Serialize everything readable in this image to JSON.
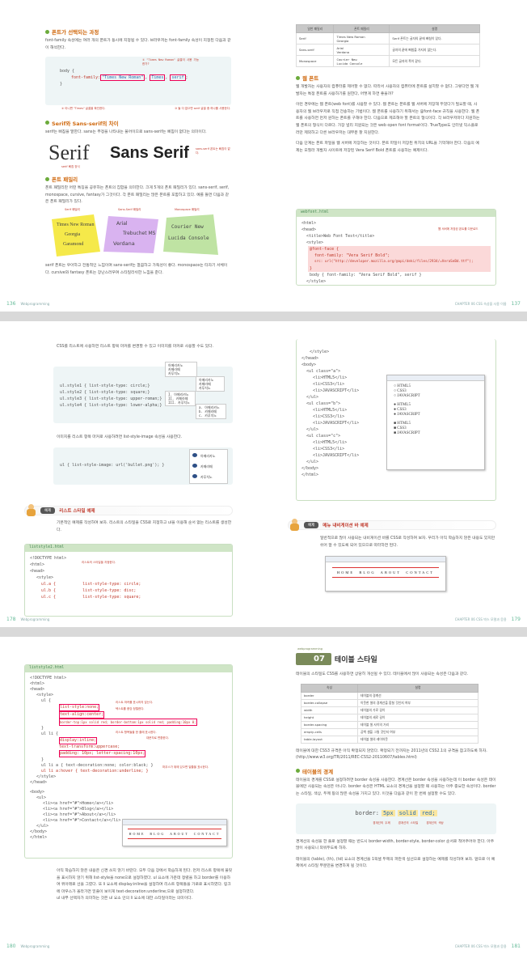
{
  "spread1": {
    "left": {
      "h1": "폰트가 선택되는 과정",
      "p1": "font-family 속성에는 여러 개의 폰트가 동시에 지정될 수 있다. 브라우저는 font-family 속성이 지정된 다음과 같이 해석한다.",
      "code1_body": "body {",
      "code1_prop": "font-family:",
      "code1_v1": "\"Times New Roman\"",
      "code1_v2": "Times",
      "code1_v3": "serif",
      "code1_end": "}",
      "note1": "① \"Times New Roman\" 글꼴이 사용 가능 한가?",
      "note2": "② 아니면 \"Times\" 글꼴을 확인한다.",
      "note3": "③ 둘 다 없으면 serif 글꼴 중 하나를 사용한다.",
      "h2": "Serif와 Sans-serif의 차이",
      "p2": "serif는 삐침을 말한다. sans는 부정을 나타내는 불어이므로 sans-serif는 삐침이 없다는 의미이다.",
      "serif_label": "Serif",
      "sans_label": "Sans Serif",
      "serif_note": "serif 삐침 장식",
      "sans_note": "sans-serif 폰트는 삐침이 없다.",
      "h3": "폰트 패밀리",
      "p3": "폰트 패밀리란 어떤 특징을 공유하는 폰트의 집합을 의미한다. 크게 5개의 폰트 패밀리가 있다. sans-serif, serif, monospace, cursive, fantasy가 그것이다. 각 폰트 패밀리는 많은 폰트를 포함하고 있다. 예를 들면 다음과 같은 폰트 패밀리가 있다.",
      "fam1": "Serif 패밀리",
      "fam2": "Sans-Serif 패밀리",
      "fam3": "Monospace 패밀리",
      "f1a": "Times New Roman",
      "f1b": "Georgia",
      "f1c": "Garamond",
      "f2a": "Arial",
      "f2b": "Trebuchet MS",
      "f2c": "Verdana",
      "f3a": "Courier New",
      "f3b": "Lucida Console",
      "p4": "serif 폰트는 우아하고 전통적인 느낌이며 sans-serif는 깔끔하고 가독성이 좋다. monospace는 타자기 서체이다. cursive와 fantasy 폰트는 장난스러우며 스타일리쉬한 느낌을 준다.",
      "page": "136",
      "running": "Webprogramming"
    },
    "right": {
      "th1": "일반 패밀리",
      "th2": "폰트 패밀리",
      "th3": "설명",
      "rows": [
        [
          "Serif",
          "Times New Roman\nGeorgia",
          "Serif 폰트는 글자의 끝에 삐침이 있다."
        ],
        [
          "Sans-serif",
          "Arial\nVerdana",
          "글자의 끝에 삐침을 가지지 않는다."
        ],
        [
          "Monospace",
          "Courier New\nLucida Console",
          "모든 글자의 폭이 같다."
        ]
      ],
      "h1": "웹 폰트",
      "p1": "웹 개발자는 사용자의 컴퓨터를 제어할 수 없다. 따라서 사용자의 컴퓨터에 폰트를 설치할 수 없다. 그렇다면 웹 개발자는 특정 폰트를 사용하기를 원한다, 어떻게 하면 좋을까?",
      "p2": "이런 경우에는 웹 폰트(web font)를 사용할 수 있다. 웹 폰트는 폰트를 웹 서버에 저장해 두었다가 필요할 때, 사용자의 웹 브라우저로 직접 전송하는 기법이다. 웹 폰트를 사용하기 위해서는 @font-face 규칙을 사용한다. 웹 폰트를 사용하면 먼저 원하는 폰트를 구해야 한다. 다음으로 제조해야 할 폰트의 형식이다. 각 브라우저마다 지원하는 웹 폰트의 형식이 다르다. 가장 널리 지원되는 것은 web open font format이다. TrueType도 인터넷 익스플로러만 제외하고 다른 브라우저는 대부분 잘 지원한다.",
      "p3": "다음 단계는 폰트 파일을 웹 서버에 저장하는 것이다. 폰트 파일이 저장된 위치의 URL을 기억해야 한다. 다음의 예제는 모질라 개발자 사이트에 저장된 Vera Serif Bold 폰트를 사용하는 예제이다.",
      "src_title": "webfont.html",
      "c1": "<html>",
      "c2": "<head>",
      "c3": "<title>Web Font Test</title>",
      "c4": "<style>",
      "c5": "@font-face {",
      "c6": "font-family: \"Vera Serif Bold\";",
      "c7": "src: url(\"http://developer.mozilla.org/@api/deki/files/2934/=VeraSeBd.ttf\");",
      "c8": "}",
      "c9": "body { font-family: \"Vera Serif Bold\", serif }",
      "c10": "</style>",
      "c_note": "웹 서버에 저장된 폰트를 다운로드",
      "page": "137",
      "running": "CHAPTER 06 CSS 속성을 사용 이름"
    }
  },
  "spread2": {
    "left": {
      "p1": "CSS를 리스트에 사용하면 리스트 항목 마커를 변경할 수 있고 이미지를 마커로 사용할 수도 있다.",
      "l1": "ul.style1 { list-style-type: circle;}",
      "l2": "ul.style2 { list-style-type: square;}",
      "l3": "ul.style3 { list-style-type: upper-roman;}",
      "l4": "ul.style4 { list-style-type: lower-alpha;}",
      "s1": [
        "아메리카노",
        "카페라떼",
        "카푸치노"
      ],
      "s2": [
        "아메리카노",
        "카페라떼",
        "카푸치노"
      ],
      "s3": [
        "I. 아메리카노",
        "II. 카페라떼",
        "III. 카푸치노"
      ],
      "s4": [
        "a. 아메리카노",
        "b. 카페라떼",
        "c. 카푸치노"
      ],
      "p2": "이미지를 리스트 항목 마커로 사용하려면 list-style-image 속성을 사용한다.",
      "l5": "ul { list-style-image: url('bullet.png'); }",
      "img_items": [
        "아메리카노",
        "카페라떼",
        "카푸치노"
      ],
      "ex_tag": "예제",
      "ex_title": "리스트 스타일 예제",
      "p3": "기본적인 예제를 작성하여 보자. 리스트의 스타일을 CSS로 지정하고 ul을 이용해 순서 없는 리스트를 생성한다.",
      "src_title": "liststyle1.html",
      "c1": "<!DOCTYPE html>",
      "c2": "<html>",
      "c3": "<head>",
      "c4": "<style>",
      "c5": "ul.a {           list-style-type: circle;",
      "c6": "ul.b {           list-style-type: disc;",
      "c7": "ul.c {           list-style-type: square;",
      "c_note": "리스트의 스타일을 지정한다.",
      "page": "178",
      "running": "Webprogramming"
    },
    "right": {
      "c1": "</style>",
      "c2": "</head>",
      "c3": "<body>",
      "c4": "<ul class=\"a\">",
      "c5": "<li>HTML5</li>",
      "c6": "<li>CSS3</li>",
      "c7": "<li>JAVASCRIPT</li>",
      "c8": "</ul>",
      "c9": "<ul class=\"b\">",
      "c10": "<li>HTML5</li>",
      "c11": "<li>CSS3</li>",
      "c12": "<li>JAVASCRIPT</li>",
      "c13": "</ul>",
      "c14": "<ul class=\"c\">",
      "c15": "<li>HTML5</li>",
      "c16": "<li>CSS3</li>",
      "c17": "<li>JAVASCRIPT</li>",
      "c18": "</ul>",
      "c19": "</body>",
      "c20": "</html>",
      "b_items": [
        "HTML5",
        "CSS3",
        "JAVASCRIPT"
      ],
      "ex_tag": "예제",
      "ex_title": "메뉴 내비게이션 바 예제",
      "p1": "일반적으로 많이 사용되는 내비게이션 바를 CSS로 작성하여 보자. 우리가 아직 학습하지 않은 내용도 있지만 쉬어 알 수 있도록 되어 있으므로 따라하면 된다.",
      "nav": "HOME  BLOG  ABOUT  CONTACT",
      "page": "179",
      "running": "CHAPTER 06 CSS 박스 모델과 응용"
    }
  },
  "spread3": {
    "left": {
      "src_title": "liststyle2.html",
      "c1": "<!DOCTYPE html>",
      "c2": "<html>",
      "c3": "<head>",
      "c4": "<style>",
      "c5": "ul {",
      "c6": "list-style:none;",
      "c7": "text-align:center;",
      "c8": "border-top:1px solid red; border-bottom:1px solid red; padding:10px 0;",
      "c9": "}",
      "c10": "ul li {",
      "c11": "display:inline;",
      "c12": "text-transform:uppercase;",
      "c13": "padding: 10px; letter-spacing:10px;",
      "c14": "}",
      "c15": "ul li a { text-decoration:none; color:black; }",
      "c16": "ul li a:hover { text-decoration:underline; }",
      "c17": "</style>",
      "c18": "</head>",
      "c19": "<body>",
      "c20": "<ul>",
      "c21": "<li><a href=\"#\">Home</a></li>",
      "c22": "<li><a href=\"#\">Blog</a></li>",
      "c23": "<li><a href=\"#\">About</a></li>",
      "c24": "<li><a href=\"#\">Contact</a></li>",
      "c25": "</ul>",
      "c26": "</body>",
      "c27": "</html>",
      "n1": "리스트 마커를 표시하지 않는다.",
      "n2": "텍스트를 중앙 정렬한다.",
      "n3": "리스트 항목들을 한 줄에 표시한다.",
      "n4": "대문자로 변환한다.",
      "n5": "마우스가 위에 있으면 밑줄을 표시한다.",
      "nav": "HOME  BLOG  ABOUT  CONTACT",
      "p1": "아직 학습하지 않은 내용은 신경 쓰지 않기 바란다. 모두 다음 장에서 학습하게 된다. 먼저 리스트 항목에 불릿을 표시하지 않기 위해 list-style을 none으로 설정하였다. ul 요소에 가운데 정렬을 하고 border를 이용하여 위아래로 선을 그렸다. 또 li 요소에 display:inline을 설정하여 리스트 항목들을 가로로 표시하였다. 링크에 마우스가 올라가면 밑줄이 보이게 text-decoration:underline;으로 설정하였다.",
      "p2": "ul 내부 선택자가 의미하는 것은 ul 요소 안의 li 요소에 대한 스타일이라는 의미이다.",
      "page": "180",
      "running": "Webprogramming"
    },
    "right": {
      "badge_top": "webprogramming",
      "num": "07",
      "title": "테이블 스타일",
      "p1": "테이블의 스타일도 CSS를 사용하면 상당히 개선될 수 있다. 테이블에서 많이 사용되는 속성은 다음과 같다.",
      "th1": "속성",
      "th2": "설명",
      "rows": [
        [
          "border",
          "테이블의 경계선"
        ],
        [
          "border-collapse",
          "이웃한 셀의 경계선을 합칠 것인지 여부"
        ],
        [
          "width",
          "테이블의 가로 길이"
        ],
        [
          "height",
          "테이블의 세로 길이"
        ],
        [
          "border-spacing",
          "테이블 셀 사이의 거리"
        ],
        [
          "empty-cells",
          "공백 셀을 그릴 것인지 여부"
        ],
        [
          "table-layout",
          "테이블 셀의 레이아웃"
        ]
      ],
      "p2": "테이블에 대한 CSS3 규격은 아직 확정되지 않았다. 확정되기 전까지는 2011년의 CSS2.1의 규격을 참고하도록 하자. (http://www.w3.org/TR/2011/REC-CSS2-20110607/tables.html)",
      "h1": "테이블의 경계",
      "p3": "테이블의 경계를 CSS로 설정하려면 border 속성을 사용한다. 경계선은 border 속성을 사용하는데 이 border 속성은 테이블에만 사용되는 속성은 아니다. border 속성은 HTML 요소의 경계선을 설정할 때 사용하는 아주 중요한 속성이다. border는 스타일, 색상, 두께 등의 많은 속성을 가지고 있다. 이것을 다음과 같이 한 번에 설정할 수도 있다.",
      "b_prop": "border:",
      "b_v1": "5px",
      "b_v2": "solid",
      "b_v3": "red;",
      "bn1": "경계선의 두께",
      "bn2": "경계선의 스타일",
      "bn3": "경계선의 색상",
      "p4": "경계선의 속성을 한 줄로 설정할 때는 반드시 border-width, border-style, border-color 순서로 적어주어야 한다. 아주 많이 사용되니 외워두도록 하자.",
      "p5": "테이블의 (table), (th), (td) 요소의 경계선을 1픽셀 두께의 파란색 실선으로 설정하는 예제를 작성하여 보자. 앞으로 이 예제에서 스타일 부분만을 변경하게 될 것이다.",
      "page": "181",
      "running": "CHAPTER 06 CSS 박스 모델과 응용"
    }
  }
}
